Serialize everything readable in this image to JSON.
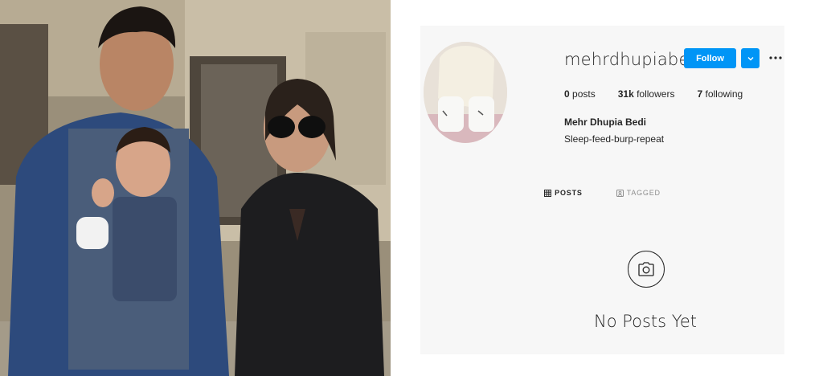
{
  "profile": {
    "username": "mehrdhupiabedi",
    "follow_label": "Follow",
    "posts_count": "0",
    "posts_label": "posts",
    "followers_count": "31k",
    "followers_label": "followers",
    "following_count": "7",
    "following_label": "following",
    "full_name": "Mehr Dhupia Bedi",
    "bio": "Sleep-feed-burp-repeat"
  },
  "tabs": [
    {
      "label": "POSTS",
      "icon": "grid-icon",
      "active": true
    },
    {
      "label": "TAGGED",
      "icon": "tag-user-icon",
      "active": false
    }
  ],
  "empty_state": {
    "icon": "camera-icon",
    "text": "No Posts Yet"
  },
  "colors": {
    "accent": "#0095f6",
    "text": "#262626",
    "muted": "#8e8e8e",
    "card_bg": "#f7f7f7"
  }
}
